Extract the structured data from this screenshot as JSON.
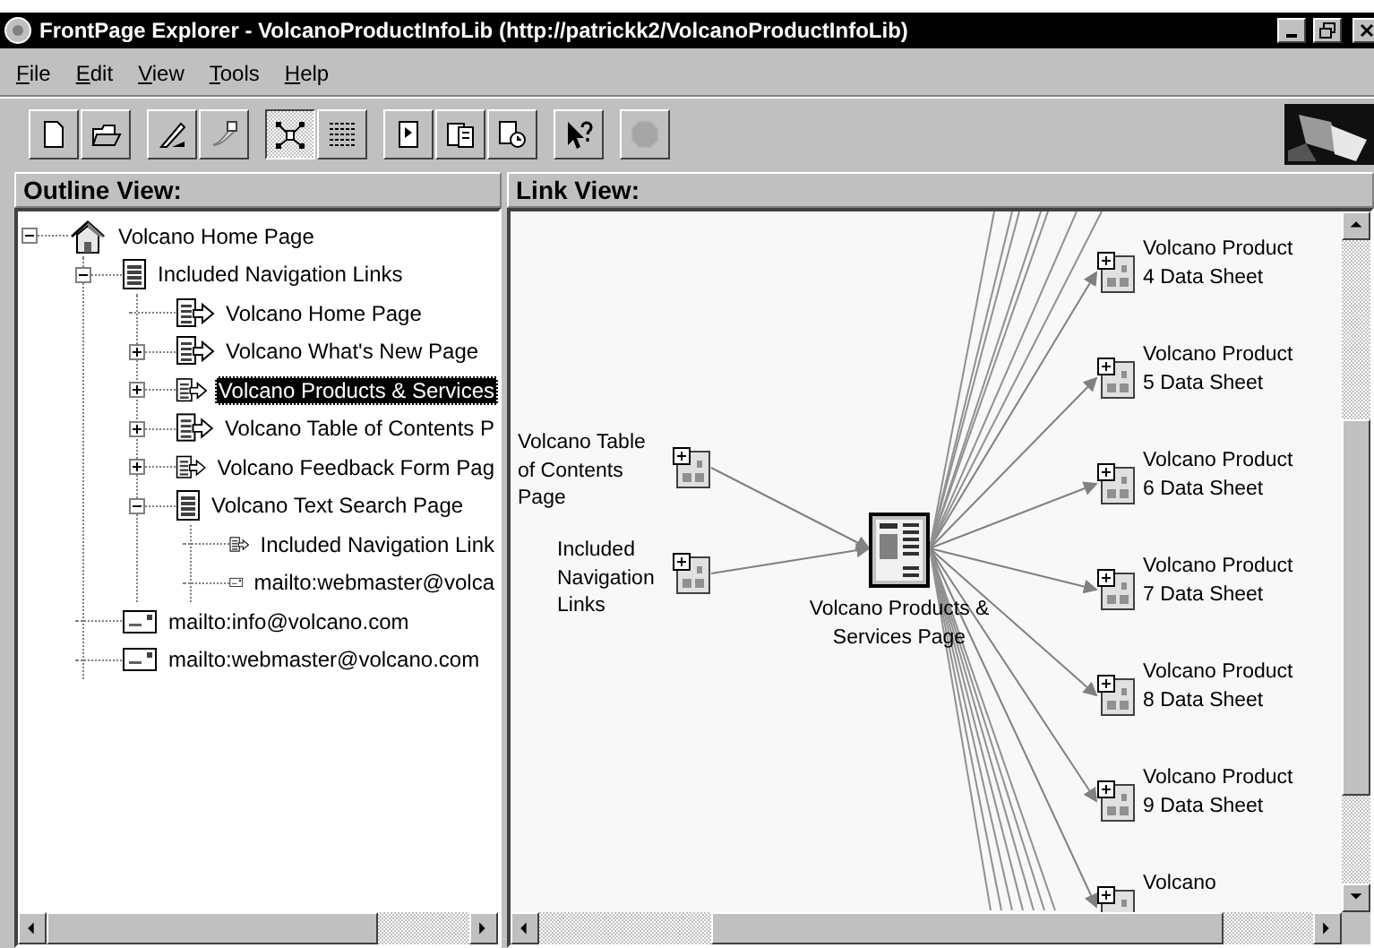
{
  "window": {
    "title": "FrontPage Explorer - VolcanoProductInfoLib (http://patrickk2/VolcanoProductInfoLib)"
  },
  "menu": [
    {
      "label": "File"
    },
    {
      "label": "Edit"
    },
    {
      "label": "View"
    },
    {
      "label": "Tools"
    },
    {
      "label": "Help"
    }
  ],
  "toolbar": [
    {
      "buttons": [
        {
          "selected": false,
          "disabled": false
        },
        {
          "selected": false,
          "disabled": false
        }
      ]
    },
    {
      "buttons": [
        {
          "selected": false,
          "disabled": false
        },
        {
          "selected": false,
          "disabled": false
        }
      ]
    },
    {
      "buttons": [
        {
          "selected": true,
          "disabled": false
        },
        {
          "selected": false,
          "disabled": false
        }
      ]
    },
    {
      "buttons": [
        {
          "selected": false,
          "disabled": false
        },
        {
          "selected": false,
          "disabled": false
        },
        {
          "selected": false,
          "disabled": false
        }
      ]
    },
    {
      "buttons": [
        {
          "selected": false,
          "disabled": false
        }
      ]
    },
    {
      "buttons": [
        {
          "selected": false,
          "disabled": true
        }
      ]
    }
  ],
  "outline": {
    "title": "Outline View:",
    "tree": [
      {
        "label": "Volcano Home Page",
        "kind": "home",
        "expanded": true,
        "selected": false,
        "children": [
          {
            "label": "Included Navigation Links",
            "kind": "page",
            "expanded": true,
            "selected": false,
            "children": [
              {
                "label": "Volcano Home Page",
                "kind": "link",
                "selected": false
              },
              {
                "label": "Volcano What's New Page",
                "kind": "link",
                "expanded": false,
                "selected": false
              },
              {
                "label": "Volcano Products & Services",
                "kind": "link",
                "expanded": false,
                "selected": true
              },
              {
                "label": "Volcano Table of Contents P",
                "kind": "link",
                "expanded": false,
                "selected": false
              },
              {
                "label": "Volcano Feedback Form Pag",
                "kind": "link",
                "expanded": false,
                "selected": false
              },
              {
                "label": "Volcano Text Search Page",
                "kind": "page",
                "expanded": true,
                "selected": false,
                "children": [
                  {
                    "label": "Included Navigation Link",
                    "kind": "link",
                    "selected": false
                  },
                  {
                    "label": "mailto:webmaster@volca",
                    "kind": "mail",
                    "selected": false
                  }
                ]
              }
            ]
          },
          {
            "label": "mailto:info@volcano.com",
            "kind": "mail",
            "selected": false
          },
          {
            "label": "mailto:webmaster@volcano.com",
            "kind": "mail",
            "selected": false
          }
        ]
      }
    ]
  },
  "link_view": {
    "title": "Link View:",
    "center": {
      "label": "Volcano Products & Services Page"
    },
    "incoming": [
      {
        "label": "Volcano Table of Contents Page"
      },
      {
        "label": "Included Navigation Links"
      }
    ],
    "outgoing": [
      {
        "label": "Volcano Product 4 Data Sheet"
      },
      {
        "label": "Volcano Product 5 Data Sheet"
      },
      {
        "label": "Volcano Product 6 Data Sheet"
      },
      {
        "label": "Volcano Product 7 Data Sheet"
      },
      {
        "label": "Volcano Product 8 Data Sheet"
      },
      {
        "label": "Volcano Product 9 Data Sheet"
      },
      {
        "label": "Volcano"
      }
    ]
  }
}
